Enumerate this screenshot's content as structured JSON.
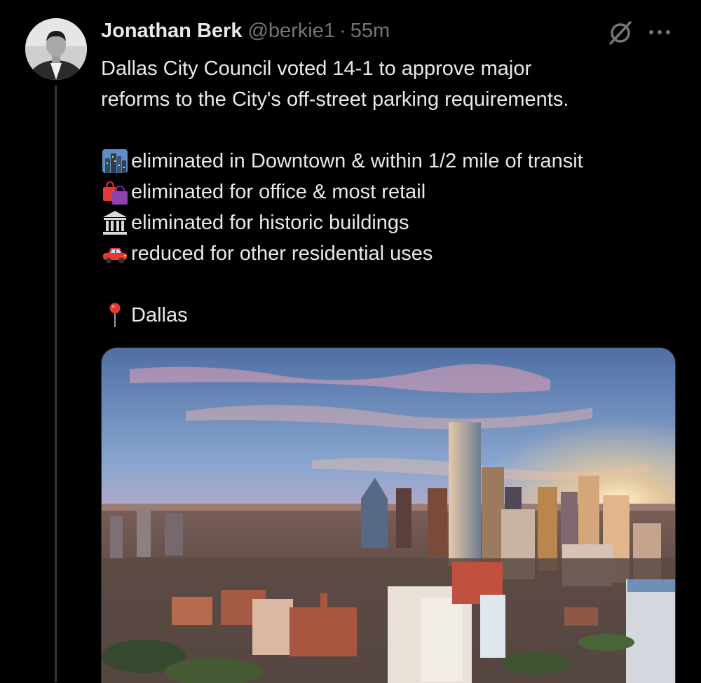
{
  "tweet": {
    "author": {
      "display_name": "Jonathan Berk",
      "handle": "@berkie1",
      "separator": "·",
      "timestamp": "55m"
    },
    "text": {
      "intro_line1": "Dallas City Council voted 14-1 to approve major",
      "intro_line2": "reforms to the City's off-street parking requirements.",
      "items": [
        {
          "icon": "cityscape-emoji",
          "text": "eliminated in Downtown & within 1/2 mile of transit"
        },
        {
          "icon": "shopping-bags-emoji",
          "text": "eliminated for office & most retail"
        },
        {
          "icon": "classical-building-emoji",
          "text": "eliminated for historic buildings"
        },
        {
          "icon": "red-car-emoji",
          "text": "reduced for other residential uses"
        }
      ],
      "location": {
        "icon": "round-pushpin-emoji",
        "text": "Dallas"
      }
    },
    "actions": {
      "grok_icon": "grok-icon",
      "more_icon": "more-horizontal-icon"
    },
    "media": {
      "type": "photo",
      "subject": "dallas-skyline-sunset"
    }
  },
  "colors": {
    "background": "#000000",
    "primary_text": "#e7e9ea",
    "secondary_text": "#71767b",
    "thread_line": "#333639"
  }
}
